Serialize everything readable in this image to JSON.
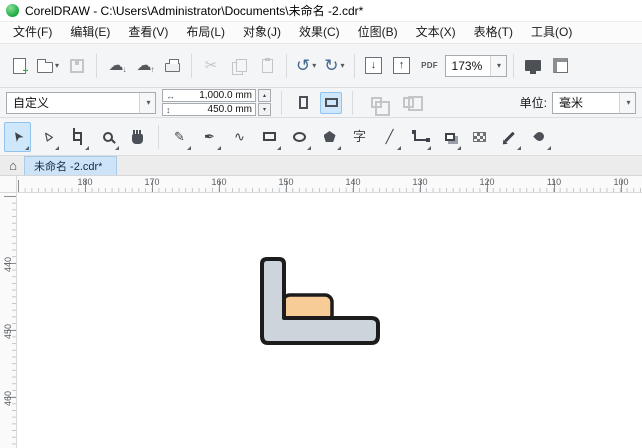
{
  "titlebar": {
    "title": "CorelDRAW - C:\\Users\\Administrator\\Documents\\未命名 -2.cdr*"
  },
  "menu": {
    "items": [
      "文件(F)",
      "编辑(E)",
      "查看(V)",
      "布局(L)",
      "对象(J)",
      "效果(C)",
      "位图(B)",
      "文本(X)",
      "表格(T)",
      "工具(O)"
    ]
  },
  "glyphs": {
    "dropdown": "▾",
    "spin_up": "▴",
    "spin_down": "▾",
    "plus": "+",
    "cloud": "☁",
    "arrow_down": "↓",
    "arrow_up": "↑",
    "undo": "↺",
    "redo": "↻",
    "scissors": "✂",
    "home": "⌂",
    "width": "↔",
    "height": "↕",
    "pick": "➤",
    "shape": "⊳",
    "pencil": "✎",
    "pen": "✒",
    "spline": "∿",
    "text": "字",
    "dimension": "╱"
  },
  "std_toolbar": {
    "pdf_label": "PDF",
    "zoom_level": "173%"
  },
  "property_bar": {
    "preset": "自定义",
    "page_width": "1,000.0 mm",
    "page_height": "450.0 mm",
    "units_label": "单位:",
    "units_value": "毫米"
  },
  "toolbox": {
    "active_tool": "pick",
    "tools": [
      "pick",
      "shape",
      "crop",
      "zoom",
      "pan",
      "freehand",
      "pen",
      "b-spline",
      "rectangle",
      "ellipse",
      "polygon",
      "text",
      "parallel-dimension",
      "connector",
      "drop-shadow",
      "transparency",
      "color-eyedropper",
      "interactive-fill"
    ]
  },
  "tabbar": {
    "active_tab": "未命名 -2.cdr*"
  },
  "rulers": {
    "horizontal": [
      "180",
      "170",
      "160",
      "150",
      "140",
      "130",
      "120",
      "110",
      "100"
    ],
    "vertical": [
      "440",
      "450",
      "460"
    ]
  },
  "canvas": {
    "shape": {
      "body_fill": "#ced4db",
      "accent_fill": "#f8cc97",
      "outline": "#1c1c1c"
    }
  },
  "colors": {
    "selection_blue": "#cfe7fb",
    "logo_green": "#1fae4b"
  }
}
